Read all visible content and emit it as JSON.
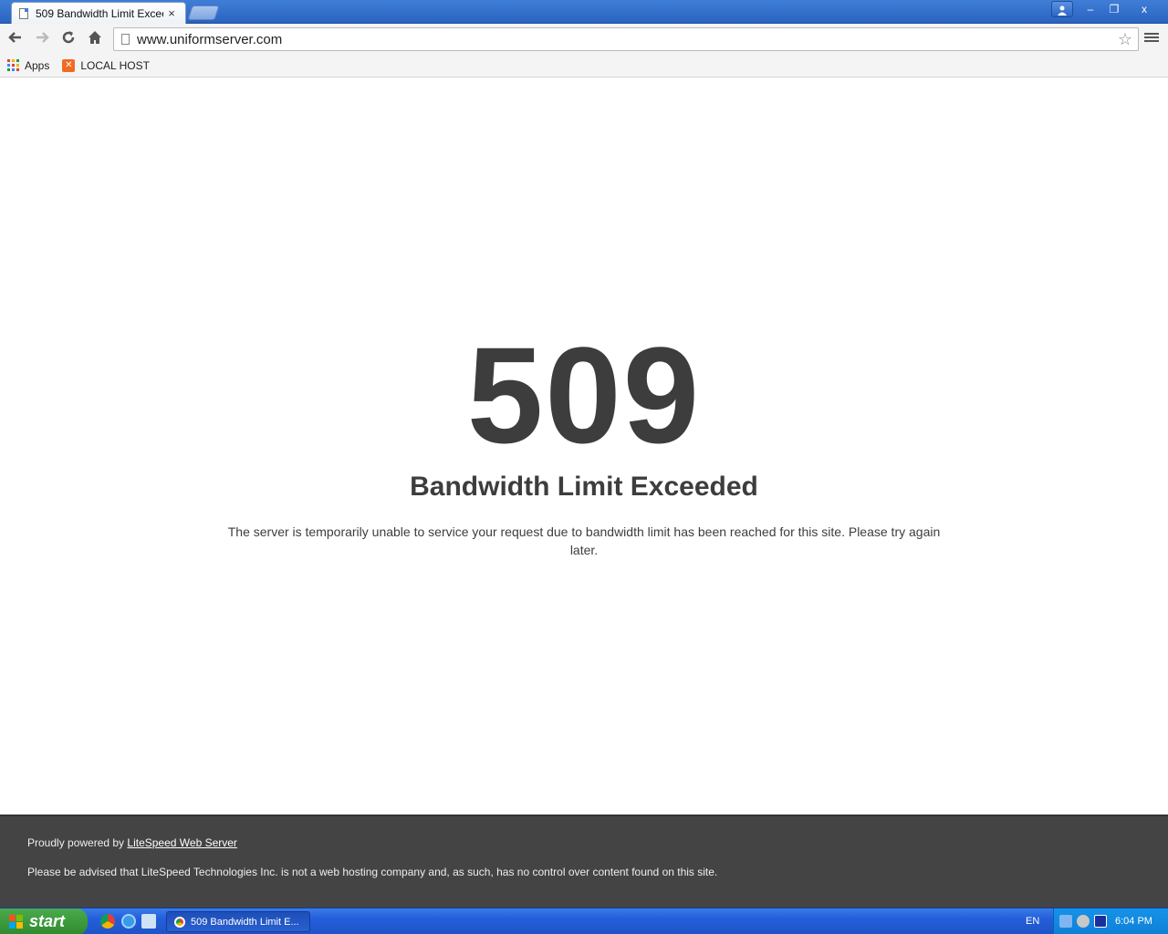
{
  "browser": {
    "tab_title": "509 Bandwidth Limit Exceeded",
    "tab_close": "×",
    "url": "www.uniformserver.com",
    "window_buttons": {
      "minimize": "–",
      "maximize": "❐",
      "close": "x"
    },
    "bookmarks": [
      {
        "label": "Apps"
      },
      {
        "label": "LOCAL HOST"
      }
    ]
  },
  "page": {
    "code": "509",
    "title": "Bandwidth Limit Exceeded",
    "message": "The server is temporarily unable to service your request due to bandwidth limit has been reached for this site. Please try again later.",
    "footer": {
      "powered_prefix": "Proudly powered by ",
      "powered_link": "LiteSpeed Web Server",
      "disclaimer": "Please be advised that LiteSpeed Technologies Inc. is not a web hosting company and, as such, has no control over content found on this site."
    }
  },
  "taskbar": {
    "start_label": "start",
    "task_item": "509 Bandwidth Limit E...",
    "language": "EN",
    "clock": "6:04 PM"
  },
  "colors": {
    "text_dark": "#3d3d3d",
    "footer_bg": "#444444",
    "taskbar_blue": "#245edb",
    "start_green": "#3d9b3d"
  }
}
